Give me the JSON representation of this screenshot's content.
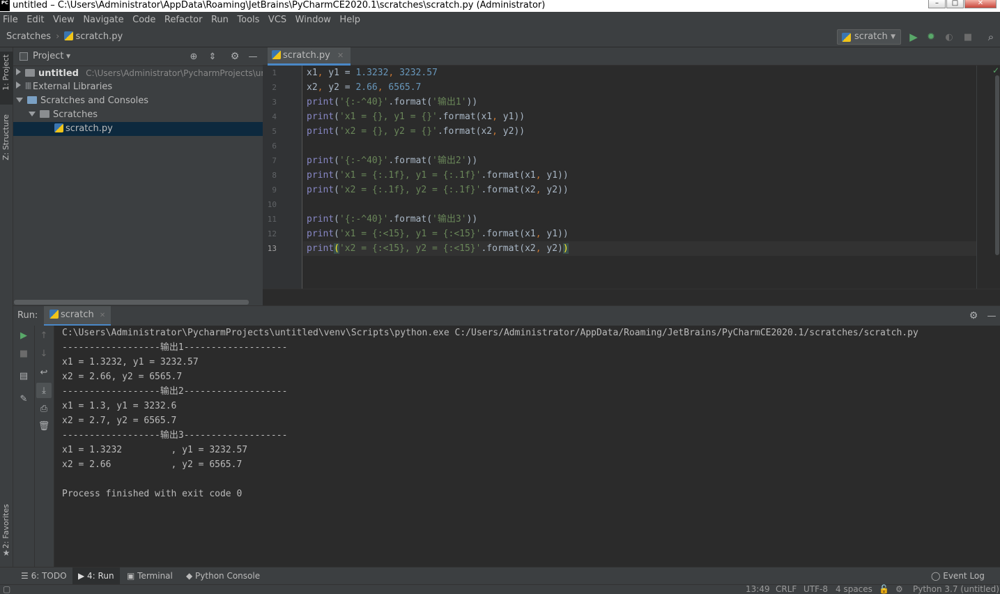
{
  "window": {
    "title": "untitled – C:\\Users\\Administrator\\AppData\\Roaming\\JetBrains\\PyCharmCE2020.1\\scratches\\scratch.py (Administrator)",
    "logo": "PC"
  },
  "menu": [
    "File",
    "Edit",
    "View",
    "Navigate",
    "Code",
    "Refactor",
    "Run",
    "Tools",
    "VCS",
    "Window",
    "Help"
  ],
  "breadcrumb": {
    "root": "Scratches",
    "file": "scratch.py"
  },
  "run_config": "scratch",
  "left_tabs": {
    "project": "1: Project",
    "structure": "Z: Structure",
    "favorites": "2: Favorites"
  },
  "project_panel": {
    "title": "Project",
    "tree": [
      {
        "label": "untitled",
        "path": "C:\\Users\\Administrator\\PycharmProjects\\untitled"
      },
      {
        "label": "External Libraries"
      },
      {
        "label": "Scratches and Consoles"
      },
      {
        "label": "Scratches"
      },
      {
        "label": "scratch.py"
      }
    ]
  },
  "editor": {
    "tab": "scratch.py",
    "line_numbers": [
      "1",
      "2",
      "3",
      "4",
      "5",
      "6",
      "7",
      "8",
      "9",
      "10",
      "11",
      "12",
      "13"
    ]
  },
  "run_panel": {
    "label": "Run:",
    "tab": "scratch",
    "output": [
      "C:\\Users\\Administrator\\PycharmProjects\\untitled\\venv\\Scripts\\python.exe C:/Users/Administrator/AppData/Roaming/JetBrains/PyCharmCE2020.1/scratches/scratch.py",
      "------------------输出1-------------------",
      "x1 = 1.3232, y1 = 3232.57",
      "x2 = 2.66, y2 = 6565.7",
      "------------------输出2-------------------",
      "x1 = 1.3, y1 = 3232.6",
      "x2 = 2.7, y2 = 6565.7",
      "------------------输出3-------------------",
      "x1 = 1.3232         , y1 = 3232.57",
      "x2 = 2.66           , y2 = 6565.7",
      "",
      "Process finished with exit code 0"
    ]
  },
  "bottom_tabs": {
    "todo": "6: TODO",
    "run": "4: Run",
    "terminal": "Terminal",
    "console": "Python Console",
    "event_log": "Event Log"
  },
  "status": {
    "position": "13:49",
    "line_sep": "CRLF",
    "encoding": "UTF-8",
    "indent": "4 spaces",
    "interpreter": "Python 3.7 (untitled)"
  }
}
